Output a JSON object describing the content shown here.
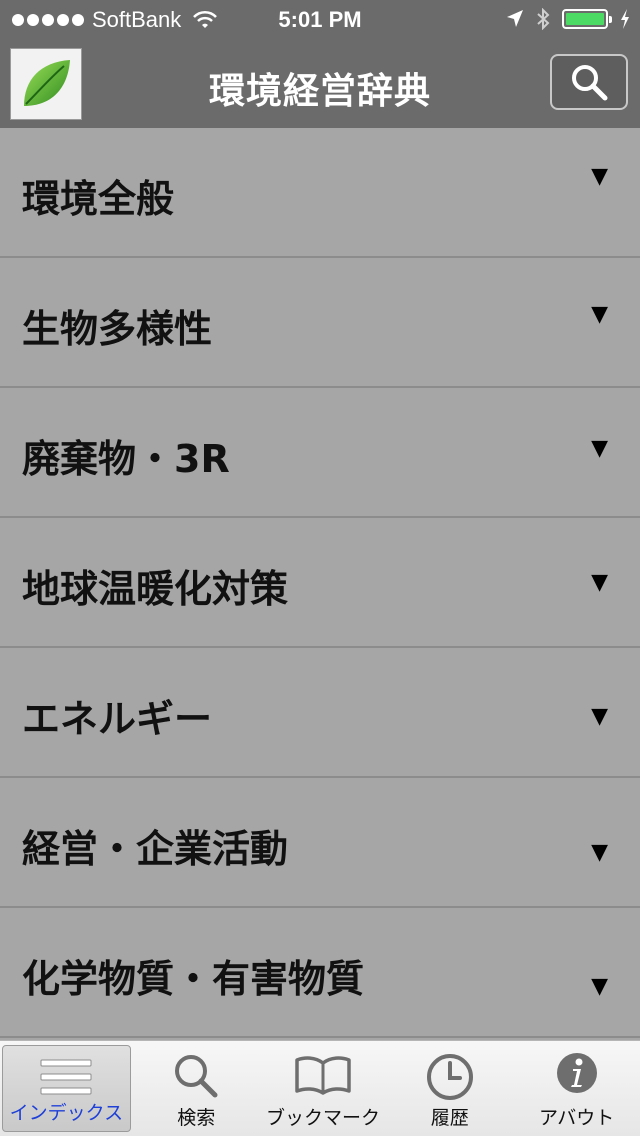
{
  "status_bar": {
    "carrier": "SoftBank",
    "time": "5:01 PM"
  },
  "nav": {
    "title": "環境経営辞典",
    "logo_icon": "leaf-icon",
    "search_icon": "search-icon"
  },
  "categories": [
    {
      "label": "環境全般"
    },
    {
      "label": "生物多様性"
    },
    {
      "label": "廃棄物・3R"
    },
    {
      "label": "地球温暖化対策"
    },
    {
      "label": "エネルギー"
    },
    {
      "label": "経営・企業活動"
    },
    {
      "label": "化学物質・有害物質"
    }
  ],
  "arrow_glyph": "▼",
  "tabs": [
    {
      "label": "インデックス",
      "icon": "list-icon",
      "active": true
    },
    {
      "label": "検索",
      "icon": "search-icon",
      "active": false
    },
    {
      "label": "ブックマーク",
      "icon": "book-icon",
      "active": false
    },
    {
      "label": "履歴",
      "icon": "clock-icon",
      "active": false
    },
    {
      "label": "アバウト",
      "icon": "info-icon",
      "active": false
    }
  ],
  "colors": {
    "bar_bg": "#6b6b6b",
    "list_bg": "#a6a6a6",
    "battery": "#4cd964",
    "active_tab_text": "#1e3fd8"
  }
}
